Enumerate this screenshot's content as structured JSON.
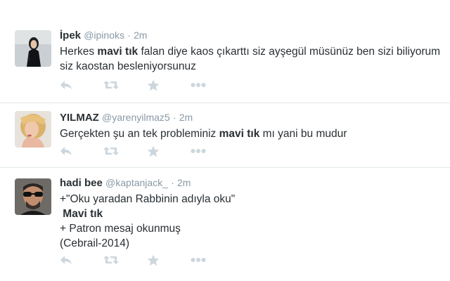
{
  "tweets": [
    {
      "name": "İpek",
      "handle": "@ipinoks",
      "separator": "·",
      "time": "2m",
      "text_parts": [
        {
          "t": "Herkes ",
          "b": false
        },
        {
          "t": "mavi tık",
          "b": true
        },
        {
          "t": " falan diye kaos çıkarttı siz ayşegül müsünüz ben sizi biliyorum siz kaostan besleniyorsunuz",
          "b": false
        }
      ]
    },
    {
      "name": "YILMAZ",
      "handle": "@yarenyilmaz5",
      "separator": "·",
      "time": "2m",
      "text_parts": [
        {
          "t": "Gerçekten şu an tek probleminiz ",
          "b": false
        },
        {
          "t": "mavi tık",
          "b": true
        },
        {
          "t": " mı yani bu mudur",
          "b": false
        }
      ]
    },
    {
      "name": "hadi bee",
      "handle": "@kaptanjack_",
      "separator": "·",
      "time": "2m",
      "lines": [
        {
          "t": "+\"Oku yaradan Rabbinin adıyla oku\"",
          "b": false
        },
        {
          "t": " Mavi tık",
          "b": true
        },
        {
          "t": "+ Patron mesaj okunmuş",
          "b": false
        },
        {
          "t": "(Cebrail-2014)",
          "b": false
        }
      ]
    }
  ],
  "action_icons": [
    "reply-icon",
    "retweet-icon",
    "favorite-icon",
    "more-icon"
  ],
  "colors": {
    "text": "#292f33",
    "muted": "#8899a6",
    "icon": "#ccd6dd",
    "divider": "#e1e8ed"
  }
}
